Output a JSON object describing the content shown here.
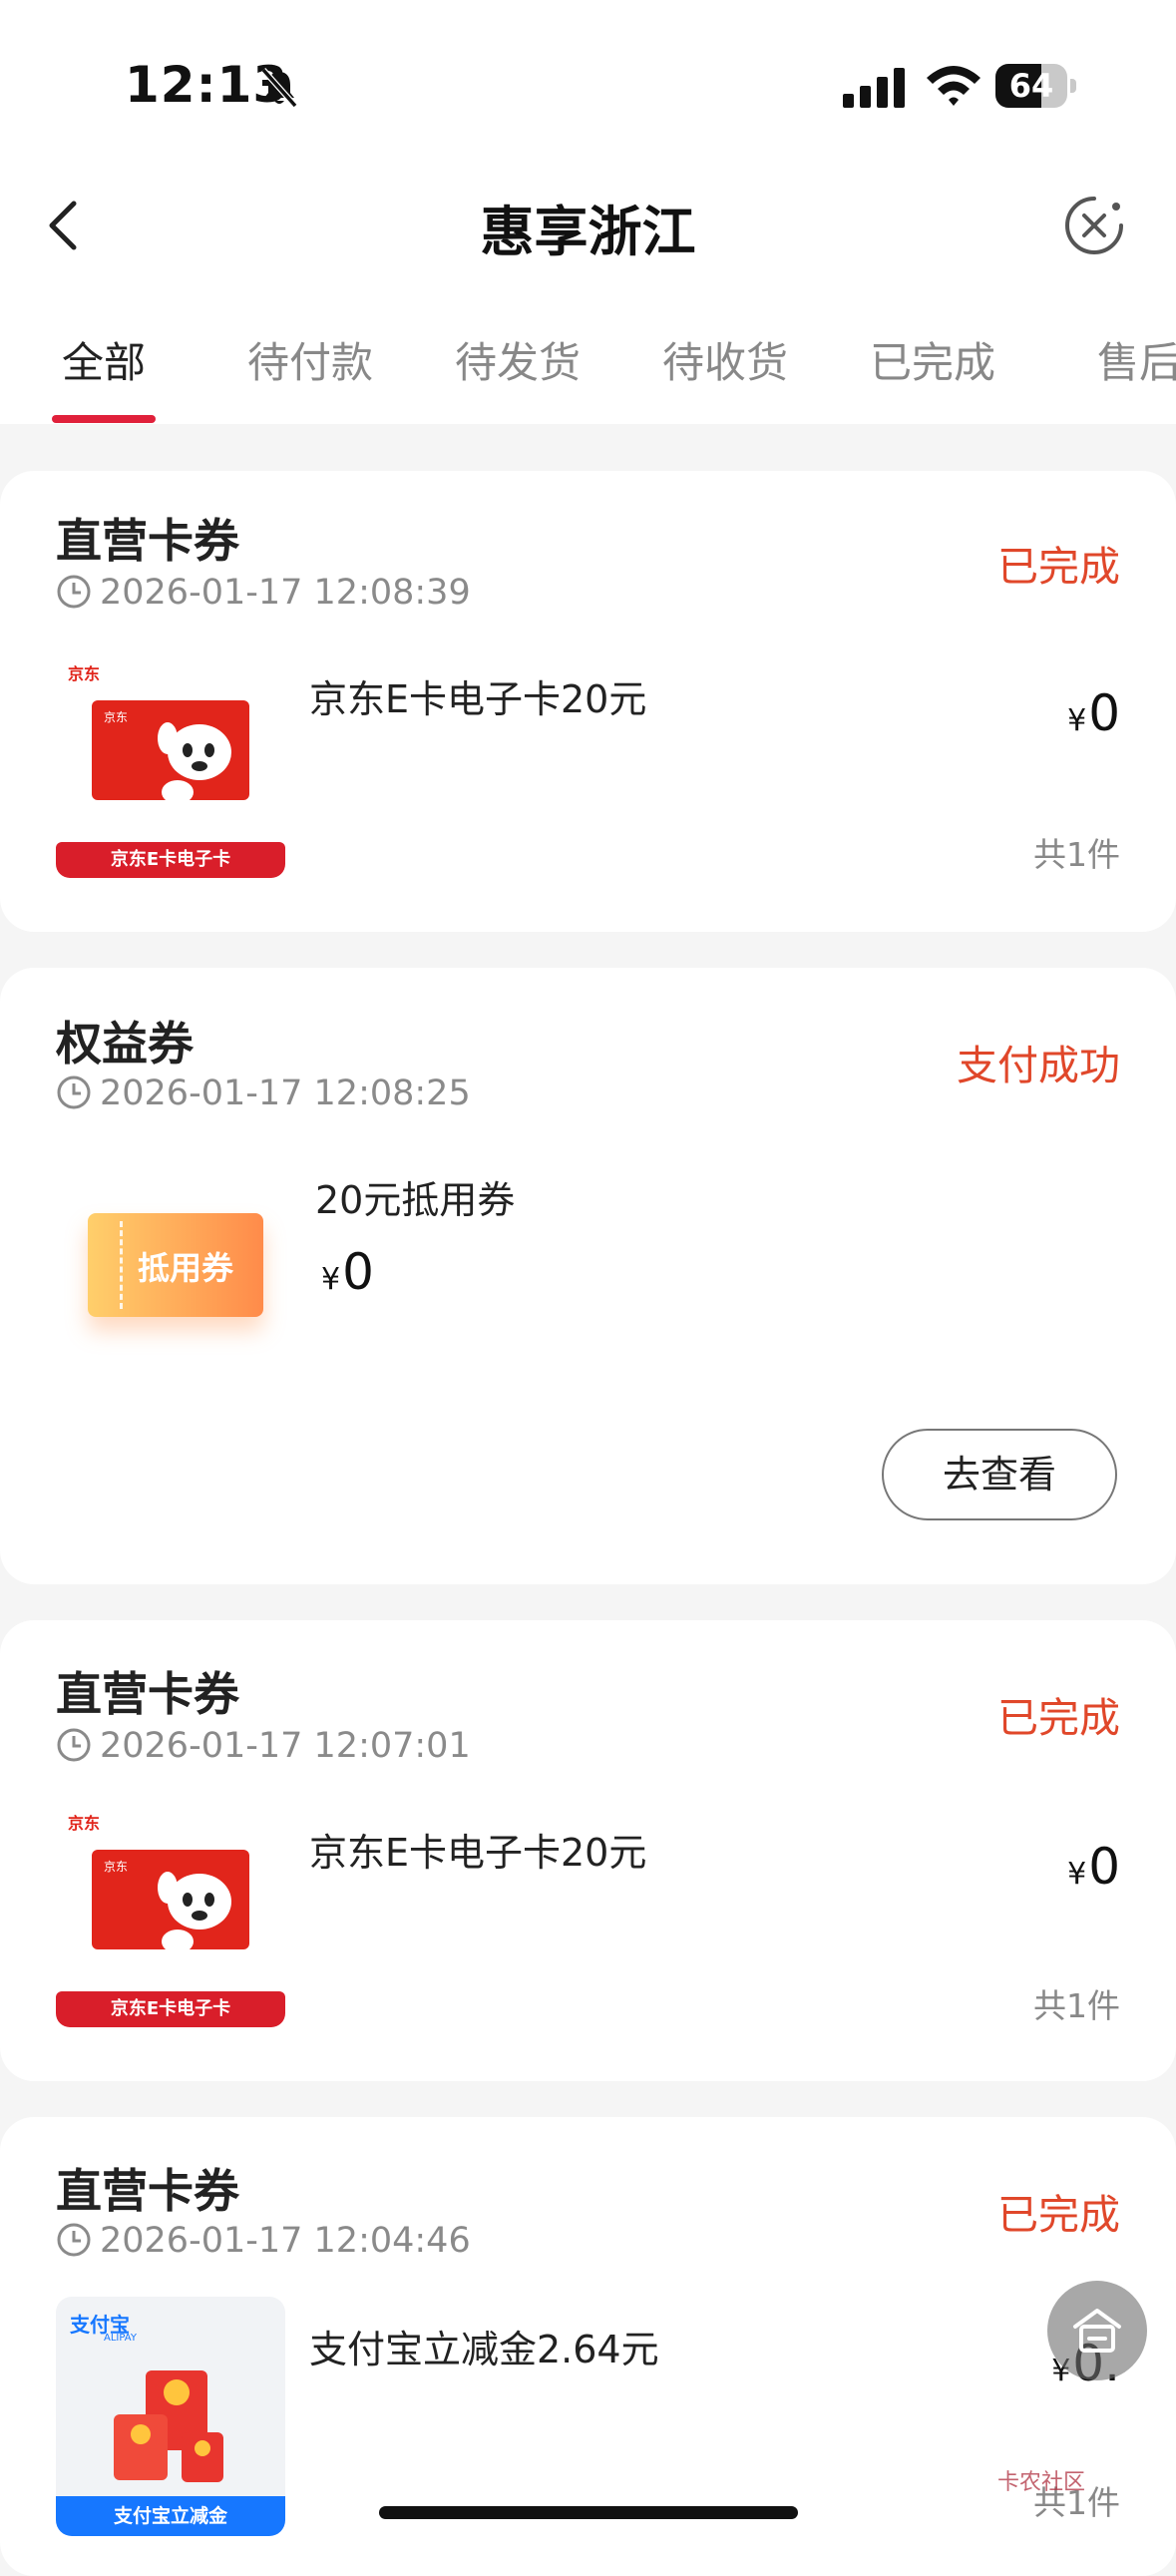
{
  "status_bar": {
    "time": "12:13",
    "battery": "64",
    "battery_level": 0.64
  },
  "nav": {
    "title": "惠享浙江"
  },
  "tabs": [
    {
      "label": "全部"
    },
    {
      "label": "待付款"
    },
    {
      "label": "待发货"
    },
    {
      "label": "待收货"
    },
    {
      "label": "已完成"
    },
    {
      "label": "售后"
    }
  ],
  "orders": [
    {
      "shop": "直营卡券",
      "time": "2026-01-17 12:08:39",
      "status": "已完成",
      "product": "京东E卡电子卡20元",
      "price_symbol": "¥",
      "price": "0",
      "count": "共1件",
      "image_banner": "京东E卡电子卡",
      "image_logo": "京东",
      "image_card_text": "京东"
    },
    {
      "shop": "权益券",
      "time": "2026-01-17 12:08:25",
      "status": "支付成功",
      "product": "20元抵用券",
      "price_symbol": "¥",
      "price": "0",
      "coupon_text": "抵用券",
      "button": "去查看"
    },
    {
      "shop": "直营卡券",
      "time": "2026-01-17 12:07:01",
      "status": "已完成",
      "product": "京东E卡电子卡20元",
      "price_symbol": "¥",
      "price": "0",
      "count": "共1件",
      "image_banner": "京东E卡电子卡",
      "image_logo": "京东",
      "image_card_text": "京东"
    },
    {
      "shop": "直营卡券",
      "time": "2026-01-17 12:04:46",
      "status": "已完成",
      "product": "支付宝立减金2.64元",
      "price_symbol": "¥",
      "price": "0.",
      "count": "共1件",
      "image_banner": "支付宝立减金",
      "image_logo": "支付宝",
      "image_logo_sub": "ALIPAY"
    }
  ],
  "watermark": "卡农社区",
  "colors": {
    "accent": "#e0203a",
    "status": "#e0472a",
    "alipay": "#1677ff",
    "jd_red": "#e1251b"
  }
}
